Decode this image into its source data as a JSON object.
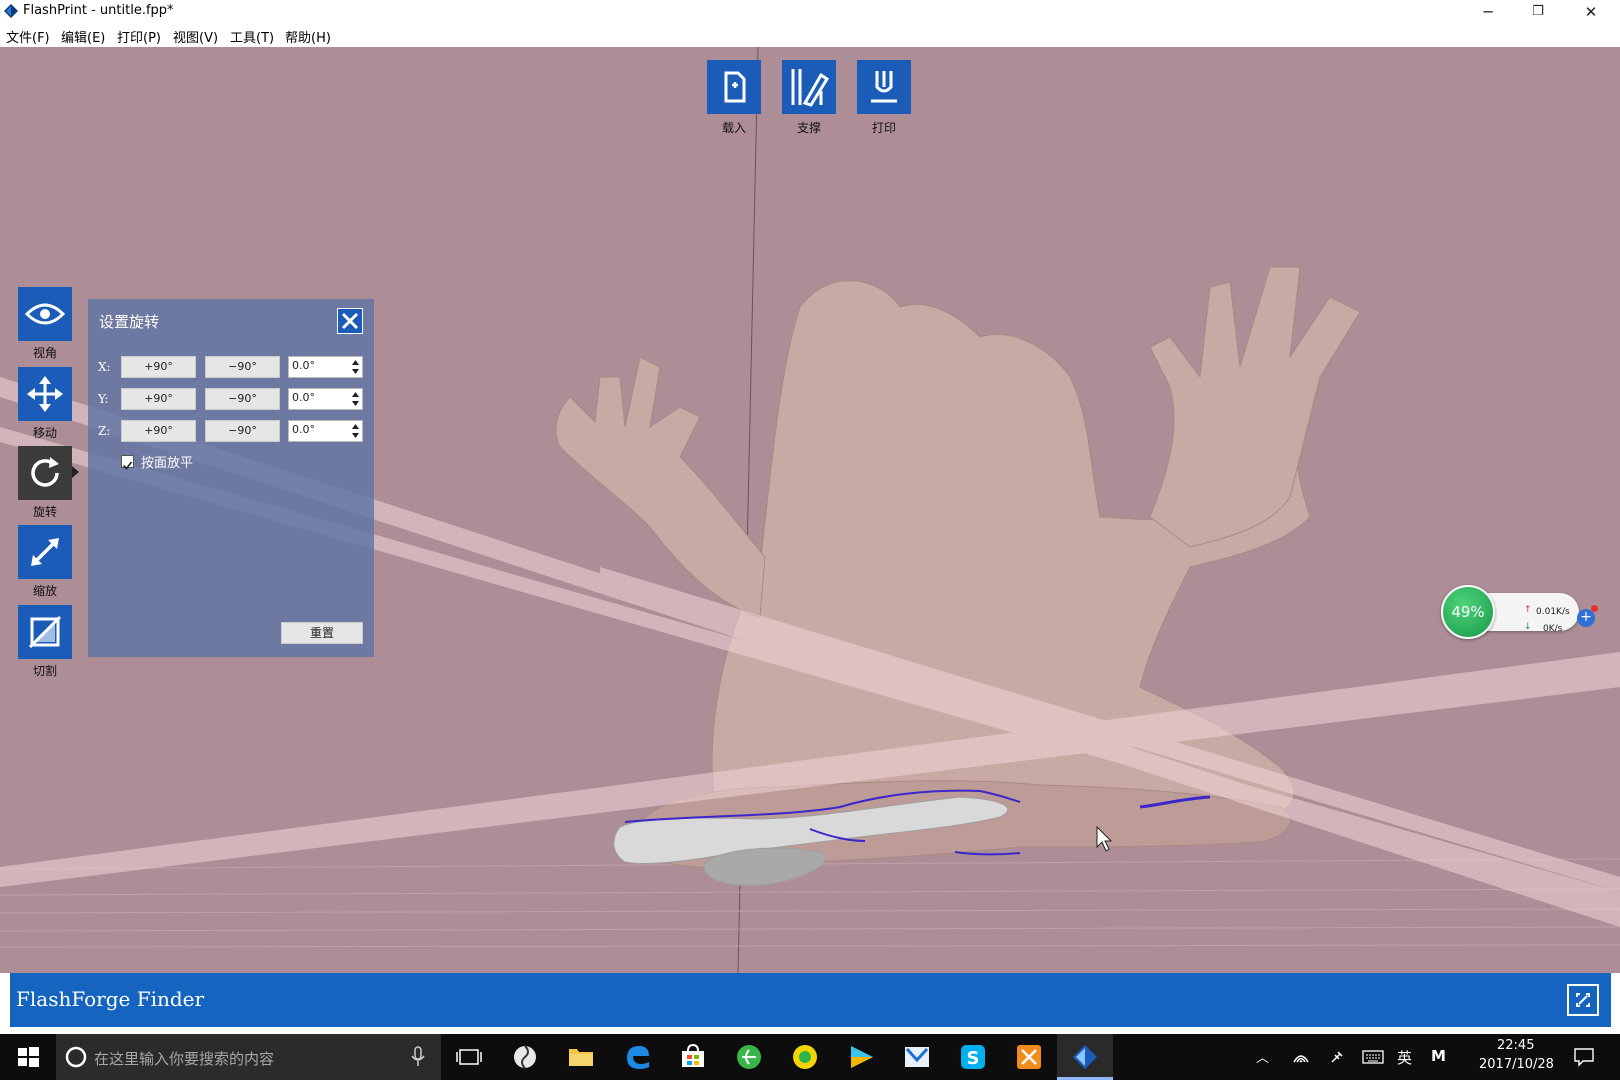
{
  "window": {
    "title": "FlashPrint - untitle.fpp*",
    "minimize": "─",
    "restore": "❐",
    "close": "✕"
  },
  "menu": [
    "文件(F)",
    "编辑(E)",
    "打印(P)",
    "视图(V)",
    "工具(T)",
    "帮助(H)"
  ],
  "top_toolbar": {
    "load": "载入",
    "support": "支撑",
    "print": "打印"
  },
  "side_toolbar": {
    "view": "视角",
    "move": "移动",
    "rotate": "旋转",
    "scale": "缩放",
    "cut": "切割",
    "active": "rotate"
  },
  "rotate_panel": {
    "title": "设置旋转",
    "rows": [
      {
        "axis": "X:",
        "plus": "+90°",
        "minus": "−90°",
        "value": "0.0°"
      },
      {
        "axis": "Y:",
        "plus": "+90°",
        "minus": "−90°",
        "value": "0.0°"
      },
      {
        "axis": "Z:",
        "plus": "+90°",
        "minus": "−90°",
        "value": "0.0°"
      }
    ],
    "lay_flat_label": "按面放平",
    "lay_flat_checked": true,
    "reset_label": "重置"
  },
  "net_monitor": {
    "percent": "49%",
    "upload": "0.01K/s",
    "download": "0K/s"
  },
  "finder": {
    "title": "FlashForge Finder"
  },
  "taskbar": {
    "search_placeholder": "在这里输入你要搜索的内容",
    "ime": "英",
    "ime2": "M",
    "time": "22:45",
    "date": "2017/10/28"
  },
  "colors": {
    "viewport_bg": "#ad8e96",
    "model": "#c9a9a3",
    "accent": "#1a5cb8",
    "finder_bar": "#1565c0",
    "support_line": "#3a28c9"
  }
}
